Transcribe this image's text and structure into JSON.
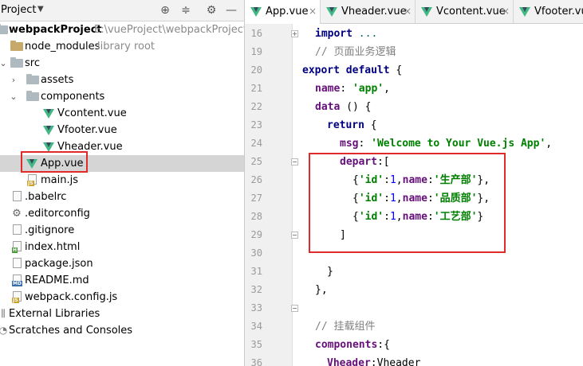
{
  "project_panel": {
    "title": "Project",
    "tree": [
      {
        "label": "webpackProject",
        "hint": "E:\\vueProject\\webpackProject",
        "kind": "folder"
      },
      {
        "label": "node_modules",
        "hint": "library root",
        "kind": "lib-folder"
      },
      {
        "label": "src",
        "kind": "folder"
      },
      {
        "label": "assets",
        "kind": "folder"
      },
      {
        "label": "components",
        "kind": "folder"
      },
      {
        "label": "Vcontent.vue",
        "kind": "vue"
      },
      {
        "label": "Vfooter.vue",
        "kind": "vue"
      },
      {
        "label": "Vheader.vue",
        "kind": "vue"
      },
      {
        "label": "App.vue",
        "kind": "vue"
      },
      {
        "label": "main.js",
        "kind": "js"
      },
      {
        "label": ".babelrc",
        "kind": "file"
      },
      {
        "label": ".editorconfig",
        "kind": "config"
      },
      {
        "label": ".gitignore",
        "kind": "file"
      },
      {
        "label": "index.html",
        "kind": "html"
      },
      {
        "label": "package.json",
        "kind": "file"
      },
      {
        "label": "README.md",
        "kind": "md"
      },
      {
        "label": "webpack.config.js",
        "kind": "js"
      },
      {
        "label": "External Libraries",
        "kind": "library"
      },
      {
        "label": "Scratches and Consoles",
        "kind": "scratch"
      }
    ]
  },
  "editor": {
    "tabs": [
      {
        "label": "App.vue",
        "active": true
      },
      {
        "label": "Vheader.vue",
        "active": false
      },
      {
        "label": "Vcontent.vue",
        "active": false
      },
      {
        "label": "Vfooter.vue",
        "active": false
      }
    ],
    "line_numbers": [
      "16",
      "19",
      "20",
      "21",
      "22",
      "23",
      "24",
      "25",
      "26",
      "27",
      "28",
      "29",
      "30",
      "31",
      "32",
      "33",
      "34",
      "35",
      "36"
    ],
    "code": {
      "l16_kw": "import",
      "l16_rest": " ...",
      "l19": "// 页面业务逻辑",
      "l20_kw": "export default",
      "l20_rest": " {",
      "l21_prop": "name",
      "l21_colon": ": ",
      "l21_str": "'app'",
      "l21_end": ",",
      "l22_kw": "data",
      "l22_rest": " () {",
      "l23_kw": "return",
      "l23_rest": " {",
      "l24_prop": "msg",
      "l24_colon": ": ",
      "l24_str": "'Welcome to Your Vue.js App'",
      "l24_end": ",",
      "l25_prop": "depart",
      "l25_rest": ":[",
      "items": [
        {
          "open": "{",
          "k1": "'id'",
          "c1": ":",
          "v1": "1",
          "sep": ",",
          "k2": "name",
          "c2": ":",
          "v2": "'生产部'",
          "close": "},"
        },
        {
          "open": "{",
          "k1": "'id'",
          "c1": ":",
          "v1": "1",
          "sep": ",",
          "k2": "name",
          "c2": ":",
          "v2": "'品质部'",
          "close": "},"
        },
        {
          "open": "{",
          "k1": "'id'",
          "c1": ":",
          "v1": "1",
          "sep": ",",
          "k2": "name",
          "c2": ":",
          "v2": "'工艺部'",
          "close": "}"
        }
      ],
      "l29": "]",
      "l31": "}",
      "l32": "},",
      "l34": "// 挂载组件",
      "l35_prop": "components",
      "l35_rest": ":{",
      "l36_prop": "Vheader",
      "l36_rest": ":Vheader"
    }
  },
  "colors": {
    "highlight": "#e02b2b",
    "keyword": "#000080",
    "string": "#008000",
    "property": "#660e7a",
    "number": "#0000ff",
    "comment": "#808080",
    "selection": "#d5d5d5"
  },
  "icons": {
    "target": "crosshair-icon",
    "collapse": "collapse-all-icon",
    "settings": "gear-icon",
    "hide": "hide-panel-icon"
  }
}
